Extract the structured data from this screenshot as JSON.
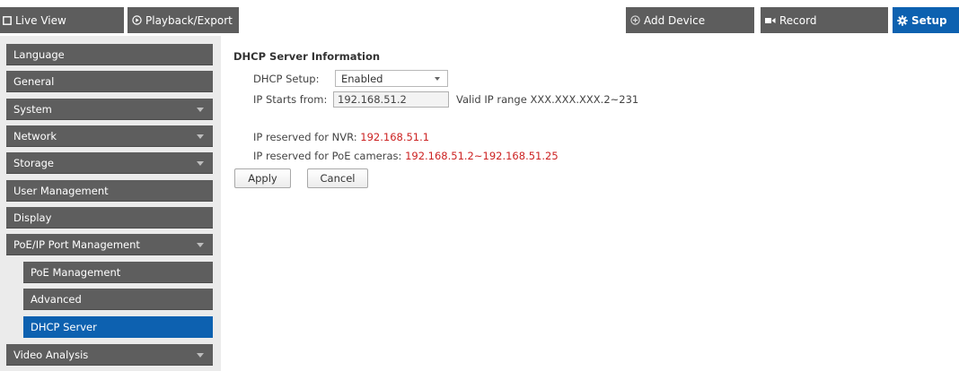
{
  "topbar": {
    "tabs": [
      {
        "label": "Live View",
        "icon": "live-view-icon"
      },
      {
        "label": "Playback/Export",
        "icon": "play-circle-icon"
      },
      {
        "label": "Add Device",
        "icon": "add-circle-icon"
      },
      {
        "label": "Record",
        "icon": "record-camera-icon"
      },
      {
        "label": "Setup",
        "icon": "gear-icon"
      }
    ],
    "active_tab": "Setup"
  },
  "sidebar": {
    "items": [
      {
        "label": "Language"
      },
      {
        "label": "General"
      },
      {
        "label": "System"
      },
      {
        "label": "Network"
      },
      {
        "label": "Storage"
      },
      {
        "label": "User Management"
      },
      {
        "label": "Display"
      },
      {
        "label": "PoE/IP Port Management"
      },
      {
        "label": "PoE Management"
      },
      {
        "label": "Advanced"
      },
      {
        "label": "DHCP Server"
      },
      {
        "label": "Video Analysis"
      }
    ]
  },
  "main": {
    "section_title": "DHCP Server Information",
    "dhcp_setup": {
      "label": "DHCP Setup:",
      "value": "Enabled"
    },
    "ip_start": {
      "label": "IP Starts from:",
      "value": "192.168.51.2",
      "hint": "Valid IP range XXX.XXX.XXX.2~231"
    },
    "nvr_reserved": {
      "label": "IP reserved for NVR:",
      "value": "192.168.51.1"
    },
    "poe_reserved": {
      "label": "IP reserved for PoE cameras:",
      "value": "192.168.51.2~192.168.51.25"
    },
    "apply_label": "Apply",
    "cancel_label": "Cancel"
  },
  "colors": {
    "accent": "#0d61b0",
    "tab_bg": "#5d5d5d",
    "reserved_ip": "#cc2222"
  }
}
